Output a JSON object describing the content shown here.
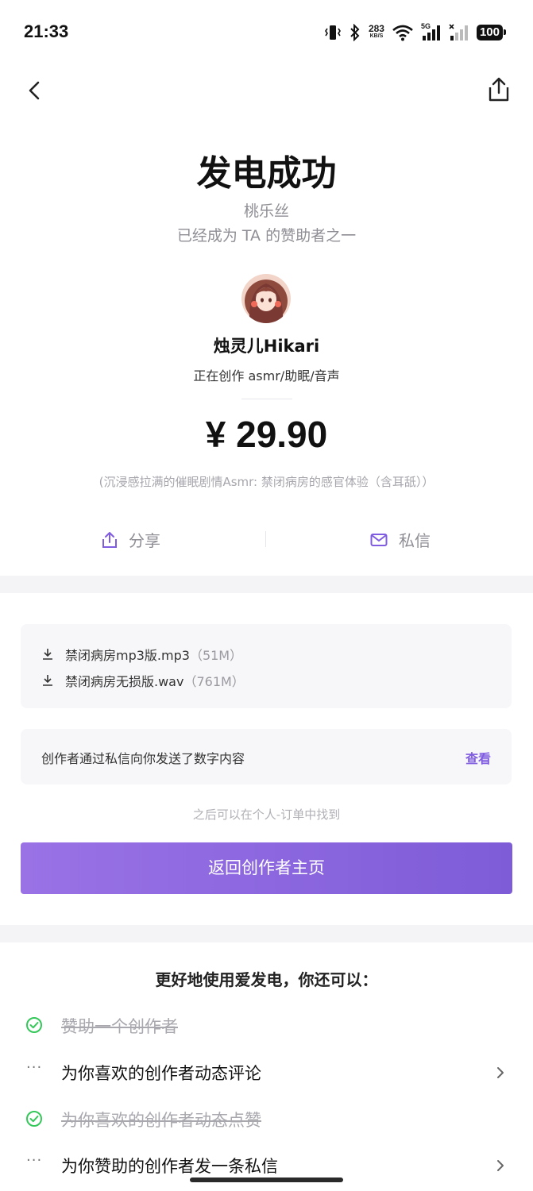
{
  "status_bar": {
    "time": "21:33",
    "net_speed": "283",
    "net_speed_unit": "KB/S",
    "network_label": "5G",
    "battery": "100"
  },
  "header": {
    "back_icon": "chevron-left-icon",
    "share_icon": "share-icon"
  },
  "result": {
    "title": "发电成功",
    "sponsor_name": "桃乐丝",
    "sponsor_subtitle": "已经成为 TA 的赞助者之一"
  },
  "creator": {
    "name": "烛灵儿Hikari",
    "description": "正在创作 asmr/助眠/音声"
  },
  "payment": {
    "amount": "¥ 29.90",
    "product": "(沉浸感拉满的催眠剧情Asmr: 禁闭病房的感官体验（含耳舐））"
  },
  "actions": {
    "share_label": "分享",
    "message_label": "私信"
  },
  "files": [
    {
      "name": "禁闭病房mp3版.mp3",
      "size": "（51M）"
    },
    {
      "name": "禁闭病房无损版.wav",
      "size": "（761M）"
    }
  ],
  "digital_content": {
    "text": "创作者通过私信向你发送了数字内容",
    "view_label": "查看"
  },
  "order_hint": "之后可以在个人-订单中找到",
  "back_button_label": "返回创作者主页",
  "tips": {
    "title": "更好地使用爱发电，你还可以：",
    "items": [
      {
        "label": "赞助一个创作者",
        "done": true
      },
      {
        "label": "为你喜欢的创作者动态评论",
        "done": false
      },
      {
        "label": "为你喜欢的创作者动态点赞",
        "done": true
      },
      {
        "label": "为你赞助的创作者发一条私信",
        "done": false
      }
    ],
    "pending_marker": "···"
  },
  "colors": {
    "accent": "#7f5ce0",
    "check_green": "#34c759",
    "muted_text": "#8e8e94"
  }
}
